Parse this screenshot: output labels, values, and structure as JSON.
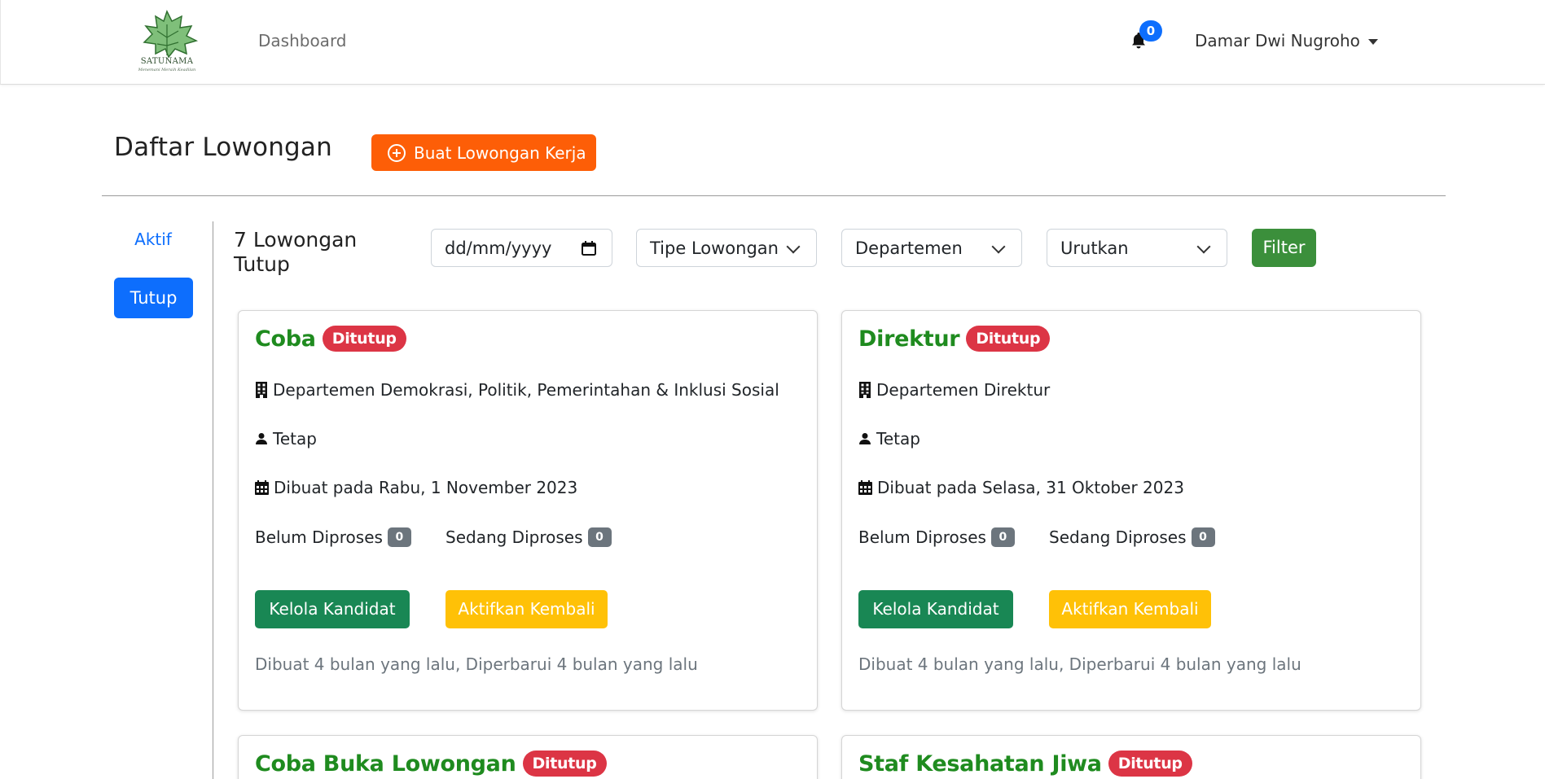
{
  "navbar": {
    "logo_text": "SATUNAMA",
    "logo_sub": "Menemani Meraih Keadilan",
    "dashboard_label": "Dashboard",
    "notification_count": "0",
    "user_name": "Damar Dwi Nugroho"
  },
  "header": {
    "title": "Daftar Lowongan",
    "create_button": "Buat Lowongan Kerja"
  },
  "side_tabs": {
    "aktif": "Aktif",
    "tutup": "Tutup"
  },
  "filters": {
    "count_title": "7 Lowongan Tutup",
    "date_placeholder": "dd/mm/yyyy",
    "type_select": "Tipe Lowongan",
    "dept_select": "Departemen",
    "sort_select": "Urutkan",
    "filter_button": "Filter"
  },
  "cards": [
    {
      "title": "Coba",
      "badge": "Ditutup",
      "department": "Departemen Demokrasi, Politik, Pemerintahan & Inklusi Sosial",
      "type": "Tetap",
      "created": "Dibuat pada Rabu, 1 November 2023",
      "unprocessed_label": "Belum Diproses",
      "unprocessed_count": "0",
      "processing_label": "Sedang Diproses",
      "processing_count": "0",
      "manage_button": "Kelola Kandidat",
      "reactivate_button": "Aktifkan Kembali",
      "footer": "Dibuat 4 bulan yang lalu, Diperbarui 4 bulan yang lalu"
    },
    {
      "title": "Direktur",
      "badge": "Ditutup",
      "department": "Departemen Direktur",
      "type": "Tetap",
      "created": "Dibuat pada Selasa, 31 Oktober 2023",
      "unprocessed_label": "Belum Diproses",
      "unprocessed_count": "0",
      "processing_label": "Sedang Diproses",
      "processing_count": "0",
      "manage_button": "Kelola Kandidat",
      "reactivate_button": "Aktifkan Kembali",
      "footer": "Dibuat 4 bulan yang lalu, Diperbarui 4 bulan yang lalu"
    },
    {
      "title": "Coba Buka Lowongan",
      "badge": "Ditutup"
    },
    {
      "title": "Staf Kesahatan Jiwa",
      "badge": "Ditutup"
    }
  ],
  "colors": {
    "brand_orange": "#fd5e07",
    "primary_blue": "#0d6efd",
    "title_green": "#1f8b1f",
    "danger_red": "#dc3545",
    "success_green": "#198754",
    "warning_yellow": "#ffc107"
  },
  "icons": [
    "bell-icon",
    "plus-circle-icon",
    "building-icon",
    "person-icon",
    "calendar-icon",
    "chevron-down-icon"
  ]
}
